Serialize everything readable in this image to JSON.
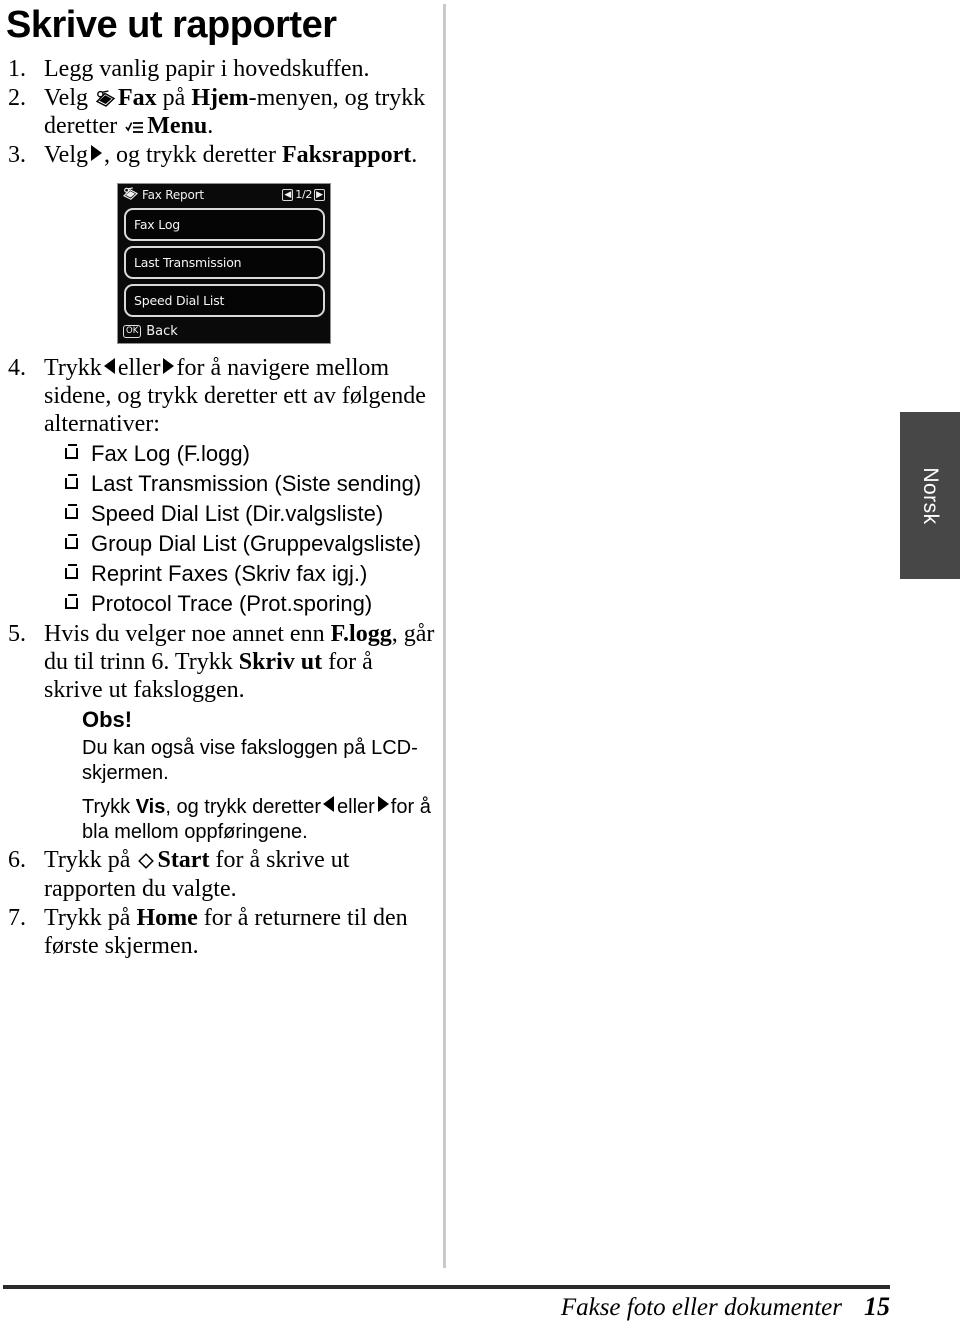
{
  "page": {
    "title": "Skrive ut rapporter",
    "footer_title": "Fakse foto eller dokumenter",
    "footer_page": "15",
    "side_tab_label": "Norsk"
  },
  "steps": [
    {
      "num": "1.",
      "text_plain": "Legg vanlig papir i hovedskuffen."
    },
    {
      "num": "2.",
      "text_plain": "Velg ⌘ Fax på Hjem-menyen, og trykk deretter ☰ Menu.",
      "seg_a": "Velg",
      "bold_fax": "Fax",
      "seg_b": "på",
      "bold_hjem": "Hjem",
      "seg_c": "-menyen, og trykk",
      "seg_d": "deretter",
      "bold_menu": "Menu",
      "seg_e": "."
    },
    {
      "num": "3.",
      "text_plain": "Velg ▶, og trykk deretter Faksrapport.",
      "seg_a": "Velg",
      "seg_b": ", og trykk deretter",
      "bold_rapport": "Faksrapport",
      "seg_c": "."
    },
    {
      "num": "4.",
      "seg_a": "Trykk",
      "seg_b": "eller",
      "seg_c": "for å navigere mellom sidene, og trykk deretter ett av følgende alternativer:"
    },
    {
      "num": "5.",
      "seg_a": "Hvis du velger noe annet enn",
      "bold_flogg": "F.logg",
      "seg_b": ", går du til trinn 6. Trykk",
      "bold_skrivut": "Skriv ut",
      "seg_c": "for å skrive ut faksloggen."
    },
    {
      "num": "6.",
      "seg_a": "Trykk på",
      "bold_start": "Start",
      "seg_b": "for å skrive ut rapporten du valgte."
    },
    {
      "num": "7.",
      "seg_a": "Trykk på",
      "bold_home": "Home",
      "seg_b": "for å returnere til den første skjermen."
    }
  ],
  "options": [
    "Fax Log (F.logg)",
    "Last Transmission (Siste sending)",
    "Speed Dial List (Dir.valgsliste)",
    "Group Dial List (Gruppevalgsliste)",
    "Reprint Faxes (Skriv fax igj.)",
    "Protocol Trace (Prot.sporing)"
  ],
  "note": {
    "title": "Obs!",
    "line1": "Du kan også vise faksloggen på LCD-skjermen.",
    "line2_a": "Trykk",
    "line2_bold": "Vis",
    "line2_b": ", og trykk deretter",
    "line2_c": "eller",
    "line2_d": "for å bla mellom oppføringene."
  },
  "lcd": {
    "header_title": "Fax Report",
    "pager_prev": "◀",
    "pager_value": "1/2",
    "pager_next": "▶",
    "items": [
      "Fax Log",
      "Last Transmission",
      "Speed Dial List"
    ],
    "footer_key": "OK",
    "footer_label": "Back"
  }
}
